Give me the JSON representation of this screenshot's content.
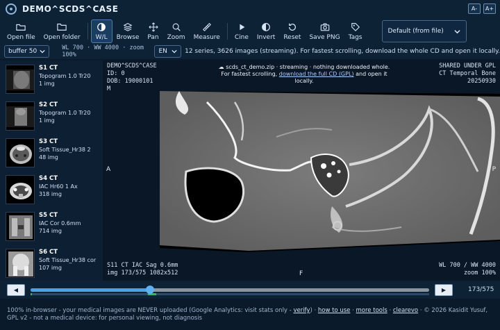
{
  "app": {
    "title": "DEMO^SCDS^CASE",
    "font_smaller": "A-",
    "font_larger": "A+"
  },
  "toolbar": {
    "tools": [
      {
        "key": "open-file",
        "label": "Open file",
        "icon": "folder-open-icon"
      },
      {
        "key": "open-folder",
        "label": "Open folder",
        "icon": "folder-icon"
      },
      {
        "key": "wl",
        "label": "W/L",
        "icon": "contrast-icon",
        "active": true
      },
      {
        "key": "browse",
        "label": "Browse",
        "icon": "layers-icon"
      },
      {
        "key": "pan",
        "label": "Pan",
        "icon": "move-icon"
      },
      {
        "key": "zoom",
        "label": "Zoom",
        "icon": "magnifier-icon"
      },
      {
        "key": "measure",
        "label": "Measure",
        "icon": "ruler-icon"
      },
      {
        "key": "cine",
        "label": "Cine",
        "icon": "play-icon"
      },
      {
        "key": "invert",
        "label": "Invert",
        "icon": "invert-icon"
      },
      {
        "key": "reset",
        "label": "Reset",
        "icon": "reset-icon"
      },
      {
        "key": "save-png",
        "label": "Save PNG",
        "icon": "camera-icon"
      },
      {
        "key": "tags",
        "label": "Tags",
        "icon": "tag-icon"
      }
    ],
    "preset_value": "Default (from file)"
  },
  "controls": {
    "buffer_value": "buffer 50",
    "wl_info": "WL 700 · WW 4000 · zoom 100%",
    "language_value": "EN",
    "status_message": "12 series, 3626 images (streaming). For fastest scrolling, download the whole CD and open it locally."
  },
  "series": [
    {
      "title": "S1 CT",
      "desc": "Topogram 1.0 Tr20",
      "count": "1 img",
      "kind": "topo"
    },
    {
      "title": "S2 CT",
      "desc": "Topogram 1.0 Tr20",
      "count": "1 img",
      "kind": "topo2"
    },
    {
      "title": "S3 CT",
      "desc": "Soft Tissue_Hr38 2",
      "count": "48 img",
      "kind": "axial"
    },
    {
      "title": "S4 CT",
      "desc": "IAC Hr60 1 Ax",
      "count": "318 img",
      "kind": "axial2"
    },
    {
      "title": "S5 CT",
      "desc": "IAC Cor 0.6mm",
      "count": "714 img",
      "kind": "coronal"
    },
    {
      "title": "S6 CT",
      "desc": "Soft Tissue_Hr38 cor",
      "count": "107 img",
      "kind": "coronal2"
    }
  ],
  "viewer": {
    "patient_name": "DEMO^SCDS^CASE",
    "patient_id": "ID: 0",
    "dob": "DOB: 19000101",
    "sex": "M",
    "license": "SHARED UNDER GPL",
    "study": "CT Temporal Bone",
    "date": "20250930",
    "notice_prefix": "☁ scds_ct_demo.zip · streaming · nothing downloaded whole. For fastest scrolling,",
    "notice_link": "download the full CD (GPL)",
    "notice_suffix": "and open it locally.",
    "orient_left": "A",
    "orient_right": "P",
    "orient_bottom": "F",
    "series_desc": "S11 CT IAC Sag 0.6mm",
    "image_info": "img 173/575  1082x512",
    "wl_overlay": "WL 700 / WW 4000",
    "zoom_overlay": "zoom 100%"
  },
  "slider": {
    "prev_label": "◀",
    "next_label": "▶",
    "position_fraction": 0.3,
    "loaded_segments": [
      [
        0.0,
        0.001
      ],
      [
        0.295,
        0.315
      ]
    ],
    "counter": "173/575"
  },
  "footer": {
    "text1": "100% in-browser - your medical images are NEVER uploaded (Google Analytics: visit stats only -",
    "link_verify": "verify",
    "sep1": ") ·",
    "link_howto": "how to use",
    "sep2": "·",
    "link_tools": "more tools",
    "sep3": "·",
    "link_clearevo": "clearevo",
    "text2": "· © 2026 Kasidit Yusuf,",
    "text3": "GPL v2 - not a medical device: for personal viewing, not diagnosis"
  },
  "colors": {
    "background": "#0b1a2b",
    "panel": "#0e2236",
    "accent": "#4aa3e6",
    "loaded": "#3fb36a"
  }
}
